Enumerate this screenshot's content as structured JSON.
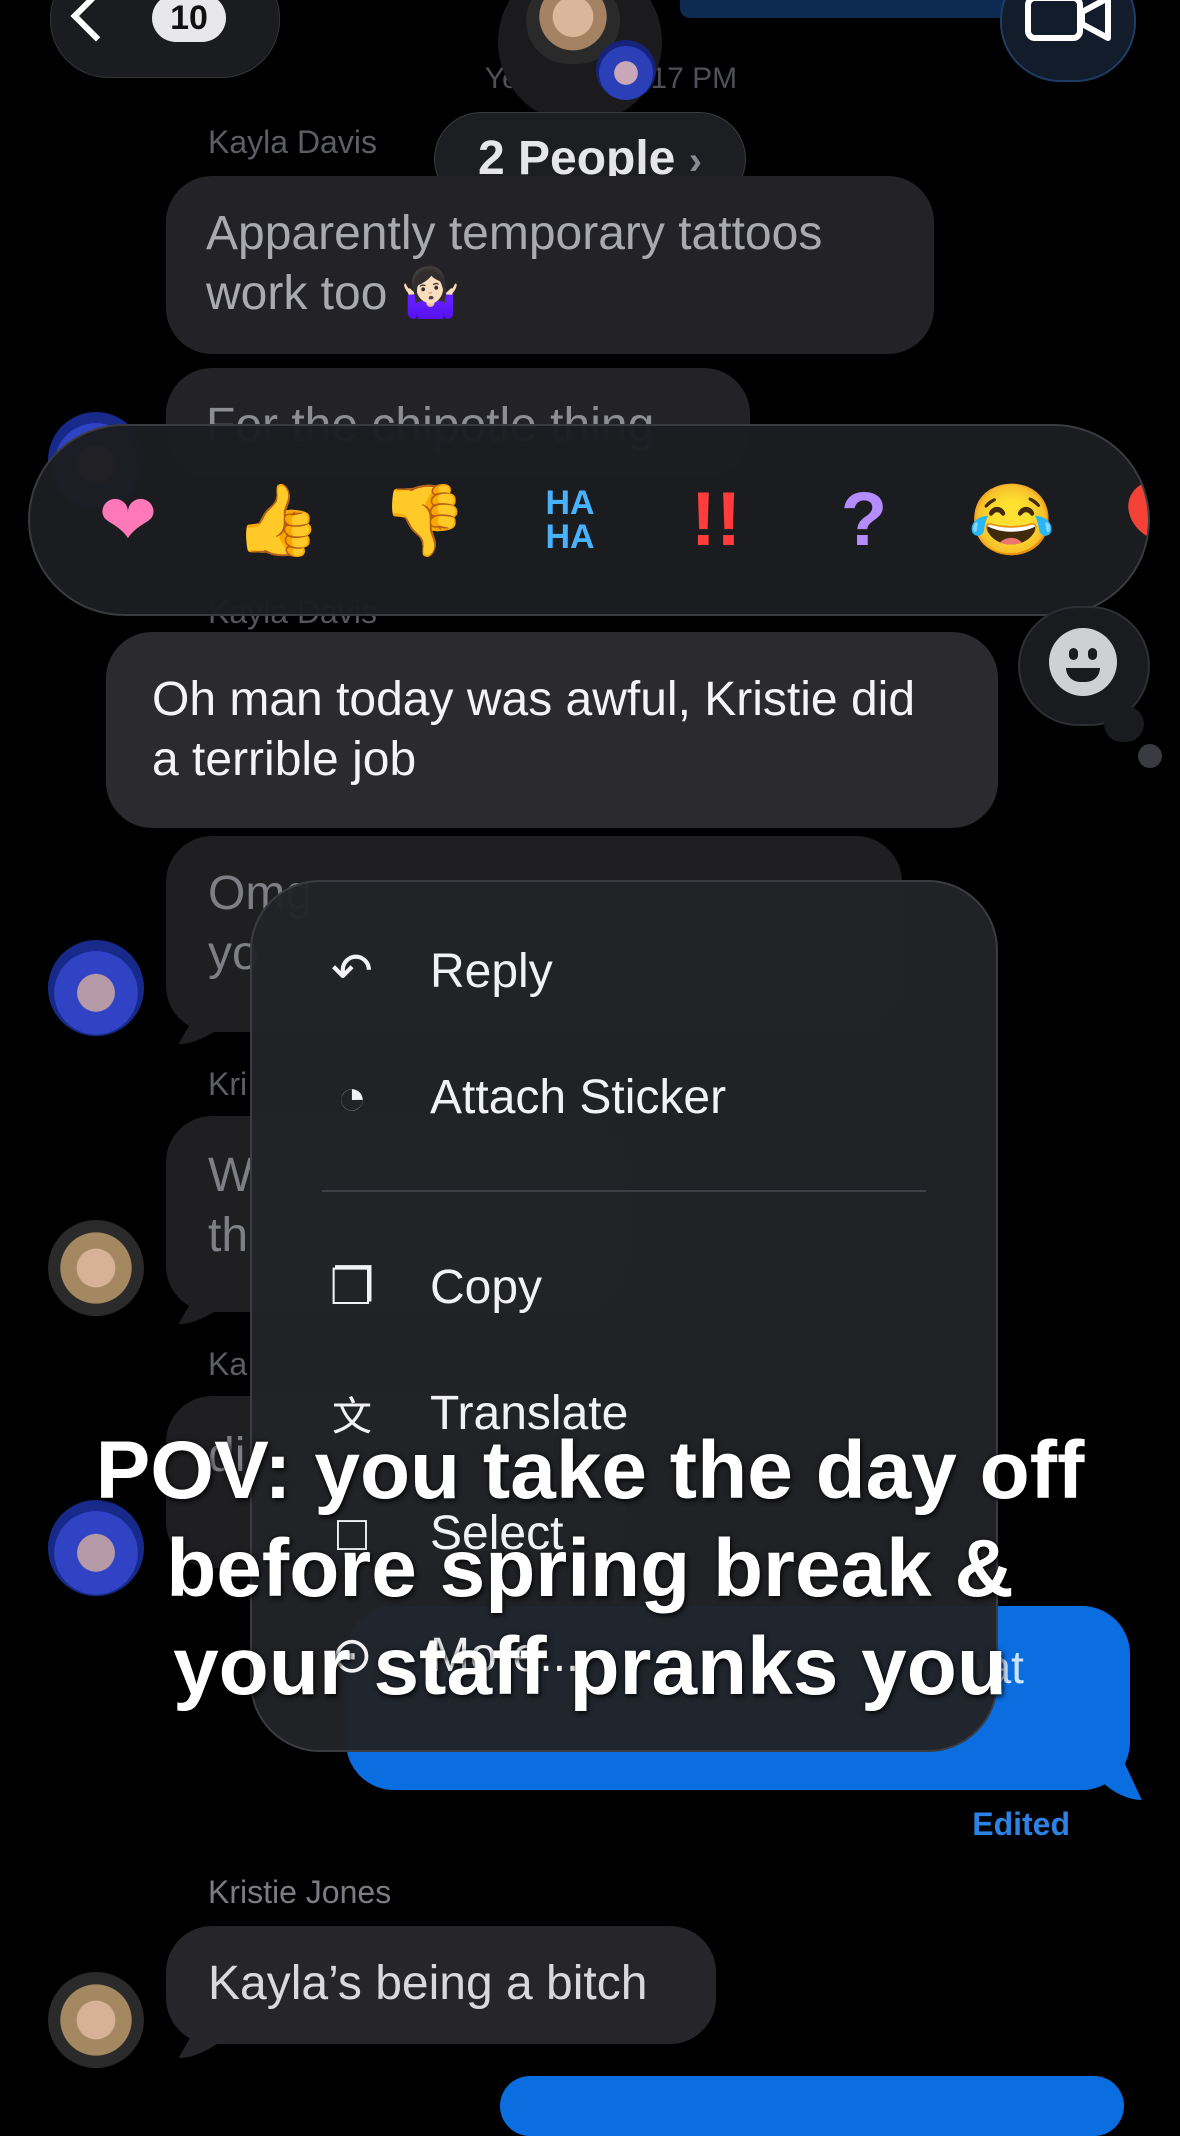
{
  "header": {
    "back_count": "10",
    "date_label": "Yesterday 5:17 PM",
    "group_label": "2 People",
    "group_chevron": "›"
  },
  "messages": {
    "m1": {
      "sender": "Kayla Davis",
      "text": "Apparently temporary tattoos work too 🤷🏻‍♀️"
    },
    "m2": {
      "text": "For the chipotle thing"
    },
    "m3": {
      "sender": "Kayla Davis",
      "text": "Oh man today was awful, Kristie did a terrible job"
    },
    "m4": {
      "text": "Omg"
    },
    "m4b": {
      "text": "yo"
    },
    "m5": {
      "sender": "Kri"
    },
    "m5a": {
      "text": "W"
    },
    "m5b": {
      "text": "th"
    },
    "m6": {
      "sender": "Ka"
    },
    "m6a": {
      "text": "di"
    },
    "out": {
      "text": "hat",
      "edited": "Edited"
    },
    "m7": {
      "sender": "Kristie Jones",
      "text": "Kayla’s being a bitch"
    }
  },
  "reactions": {
    "heart": "❤",
    "thumbs_up": "👍",
    "thumbs_down": "👎",
    "haha_top": "HA",
    "haha_bottom": "HA",
    "exclaim": "!!",
    "question": "?",
    "laugh": "😂",
    "balloon": "🎈"
  },
  "menu": {
    "reply": "Reply",
    "attach_sticker": "Attach Sticker",
    "copy": "Copy",
    "translate": "Translate",
    "select": "Select",
    "more": "More..."
  },
  "icons": {
    "reply": "↶",
    "sticker": "◔",
    "copy": "❐",
    "translate": "文",
    "select": "□",
    "more": "⊙"
  },
  "caption": {
    "line1": "POV: you take the day off",
    "line2": "before spring break &",
    "line3": "your staff pranks you"
  },
  "colors": {
    "accent_blue": "#0a6ee0",
    "edited_blue": "#2d82e6",
    "background": "#000000"
  }
}
